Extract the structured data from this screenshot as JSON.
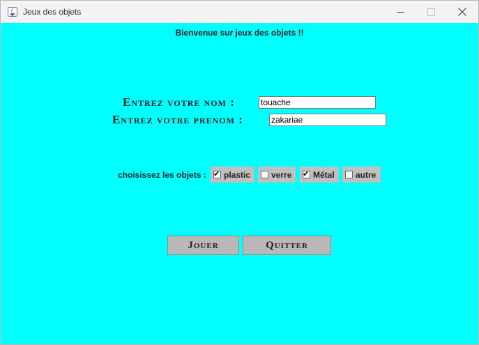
{
  "window": {
    "title": "Jeux des objets",
    "icon": "java-cup-icon"
  },
  "controls": {
    "minimize_icon": "minimize-icon",
    "maximize_icon": "maximize-icon",
    "close_icon": "close-icon"
  },
  "main": {
    "welcome": "Bienvenue sur jeux des objets !!",
    "nom_label": "Entrez votre nom :",
    "nom_value": "touache",
    "prenom_label": "Entrez votre prenom :",
    "prenom_value": "zakariae",
    "choose_label": "choisissez les objets :",
    "options": [
      {
        "label": "plastic",
        "checked": true
      },
      {
        "label": "verre",
        "checked": false
      },
      {
        "label": "Métal",
        "checked": true
      },
      {
        "label": "autre",
        "checked": false
      }
    ],
    "play_button": "Jouer",
    "quit_button": "Quitter"
  },
  "colors": {
    "background": "#00ffff",
    "button": "#b8b8b8",
    "checkbox_bg": "#c0c0c0"
  }
}
